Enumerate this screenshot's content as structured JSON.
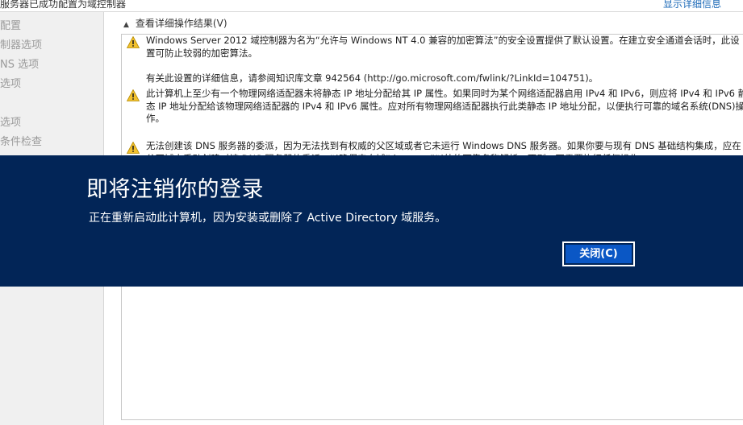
{
  "window": {
    "status_text": "服务器已成功配置为域控制器",
    "show_details_link": "显示详细信息"
  },
  "sidebar": {
    "items": [
      {
        "label": "配置"
      },
      {
        "label": "制器选项"
      },
      {
        "label": "NS 选项"
      },
      {
        "label": "选项"
      },
      {
        "label": "选项"
      },
      {
        "label": "条件检查"
      }
    ]
  },
  "main": {
    "expander_label": "查看详细操作结果(V)",
    "warnings": [
      {
        "icon": "warning-icon",
        "text": "Windows Server 2012 域控制器为名为“允许与 Windows NT 4.0 兼容的加密算法”的安全设置提供了默认设置。在建立安全通道会话时，此设置可防止较弱的加密算法。"
      },
      {
        "icon": "none",
        "text": "有关此设置的详细信息，请参阅知识库文章 942564 (http://go.microsoft.com/fwlink/?LinkId=104751)。"
      },
      {
        "icon": "warning-icon",
        "text": "此计算机上至少有一个物理网络适配器未将静态 IP 地址分配给其 IP 属性。如果同时为某个网络适配器启用 IPv4 和 IPv6，则应将 IPv4 和 IPv6 静态 IP 地址分配给该物理网络适配器的 IPv4 和 IPv6 属性。应对所有物理网络适配器执行此类静态 IP 地址分配，以便执行可靠的域名系统(DNS)操作。"
      },
      {
        "icon": "warning-icon",
        "text": "无法创建该 DNS 服务器的委派，因为无法找到有权威的父区域或者它未运行 Windows DNS 服务器。如果你要与现有 DNS 基础结构集成，应在父区域中手动创建对该 DNS 服务器的委派，以确保来自域“doo.com”以外的可靠名称解析。否则，不需要执行任何操作。"
      }
    ]
  },
  "dialog": {
    "title": "即将注销你的登录",
    "message": "正在重新启动此计算机，因为安装或删除了 Active Directory 域服务。",
    "close_button": "关闭(C)",
    "background_color": "#022557"
  }
}
